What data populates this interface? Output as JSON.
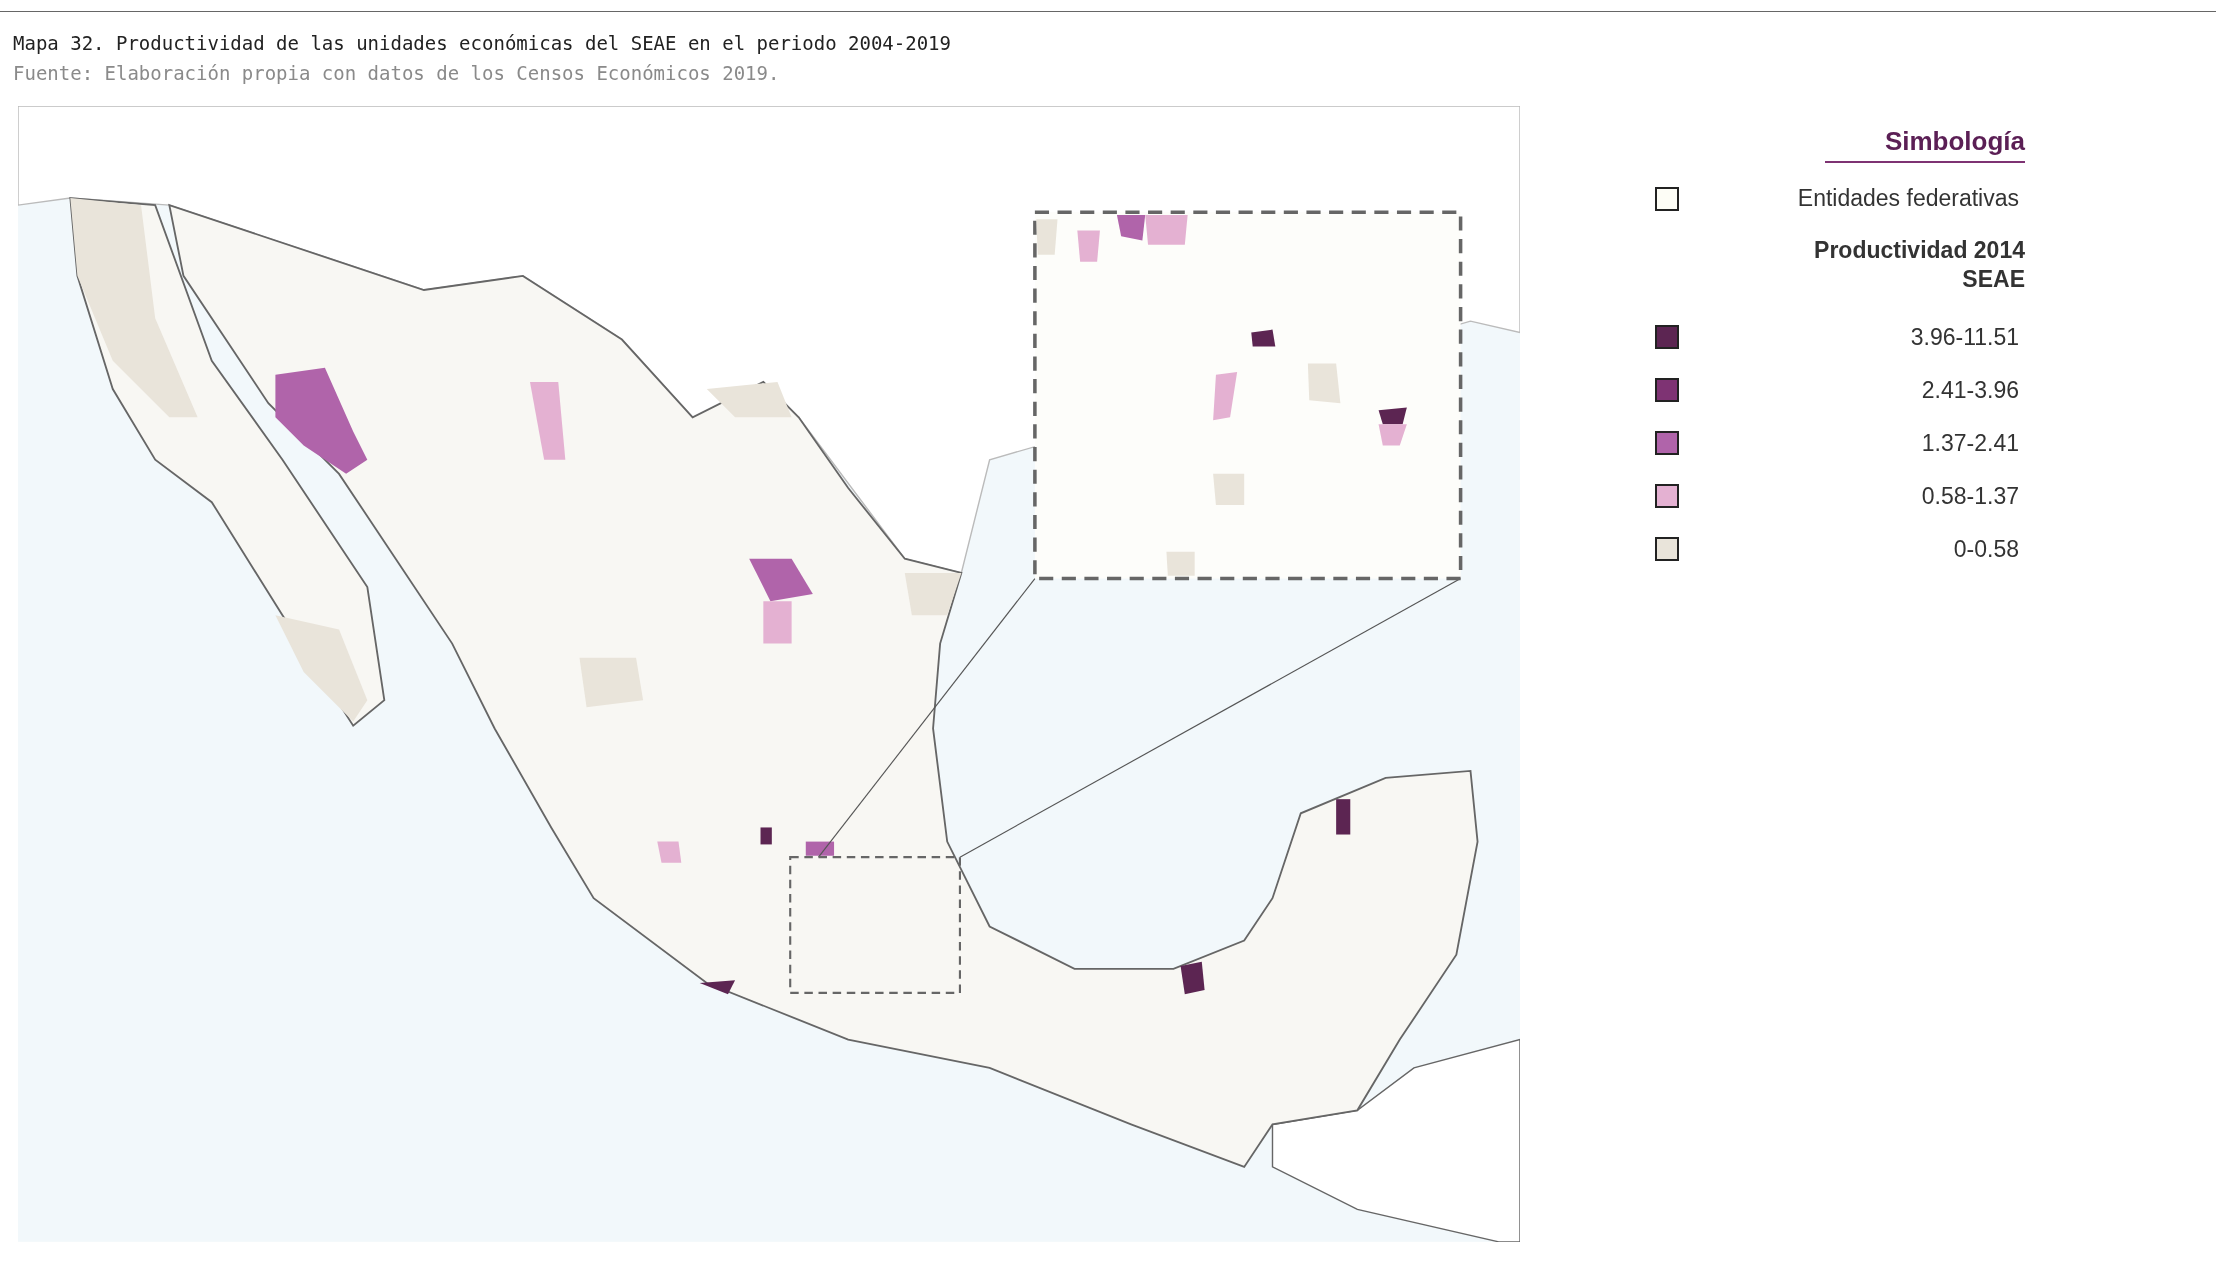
{
  "figure": {
    "title": "Mapa 32. Productividad de las unidades económicas del SEAE en el periodo 2004-2019",
    "source": "Fuente: Elaboración propia con datos de los Censos Económicos 2019."
  },
  "legend": {
    "title": "Simbología",
    "base": {
      "label": "Entidades federativas",
      "color": "#fdfdf6"
    },
    "group_title": "Productividad 2014",
    "group_subtitle": "SEAE",
    "classes": [
      {
        "label": "3.96-11.51",
        "color": "#5c2552"
      },
      {
        "label": "2.41-3.96",
        "color": "#7e3373"
      },
      {
        "label": "1.37-2.41",
        "color": "#b064aa"
      },
      {
        "label": "0.58-1.37",
        "color": "#e4b1d2"
      },
      {
        "label": "0-0.58",
        "color": "#e9e4da"
      }
    ]
  }
}
